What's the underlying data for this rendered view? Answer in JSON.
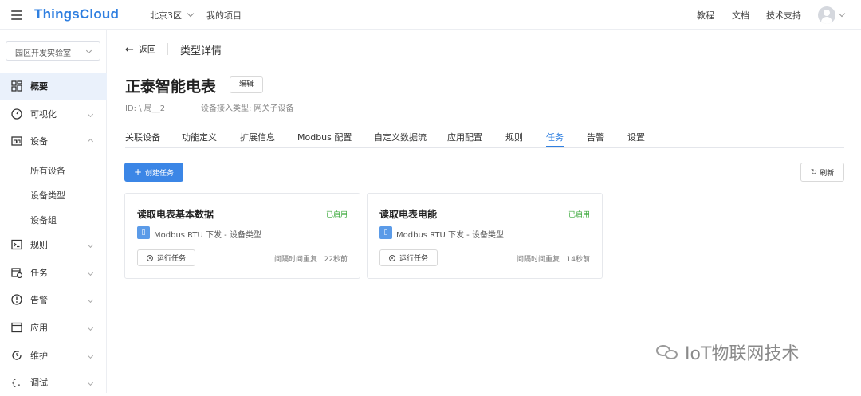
{
  "topbar": {
    "logo": "ThingsCloud",
    "region": "北京3区",
    "project": "我的项目",
    "links": [
      "教程",
      "文档",
      "技术支持"
    ]
  },
  "sidebar": {
    "lab_select": "园区开发实验室",
    "items": [
      {
        "label": "概要",
        "icon": "dashboard-icon",
        "active": true
      },
      {
        "label": "可视化",
        "icon": "gauge-icon"
      },
      {
        "label": "设备",
        "icon": "device-icon",
        "expanded": true
      },
      {
        "label": "规则",
        "icon": "terminal-icon"
      },
      {
        "label": "任务",
        "icon": "task-calendar-icon"
      },
      {
        "label": "告警",
        "icon": "alert-icon"
      },
      {
        "label": "应用",
        "icon": "app-window-icon"
      },
      {
        "label": "维护",
        "icon": "maintenance-icon"
      },
      {
        "label": "调试",
        "icon": "debug-braces-icon"
      }
    ],
    "device_sub": [
      "所有设备",
      "设备类型",
      "设备组"
    ]
  },
  "breadcrumb": {
    "back": "返回",
    "title": "类型详情"
  },
  "device": {
    "name": "正泰智能电表",
    "edit_label": "编辑",
    "id_label": "ID: \\ 局__2",
    "access_type": "设备接入类型: 网关子设备"
  },
  "tabs": [
    "关联设备",
    "功能定义",
    "扩展信息",
    "Modbus 配置",
    "自定义数据流",
    "应用配置",
    "规则",
    "任务",
    "告警",
    "设置"
  ],
  "active_tab": "任务",
  "actions": {
    "create": "创建任务",
    "refresh": "刷新"
  },
  "tasks": [
    {
      "title": "读取电表基本数据",
      "status": "已启用",
      "protocol": "Modbus RTU 下发 - 设备类型",
      "run": "运行任务",
      "repeat": "间隔时间重复",
      "ago": "22秒前"
    },
    {
      "title": "读取电表电能",
      "status": "已启用",
      "protocol": "Modbus RTU 下发 - 设备类型",
      "run": "运行任务",
      "repeat": "间隔时间重复",
      "ago": "14秒前"
    }
  ],
  "watermark": "IoT物联网技术",
  "colors": {
    "accent": "#2f7fe0",
    "enabled": "#3aa83a",
    "active_bg": "#eaf1fb"
  }
}
